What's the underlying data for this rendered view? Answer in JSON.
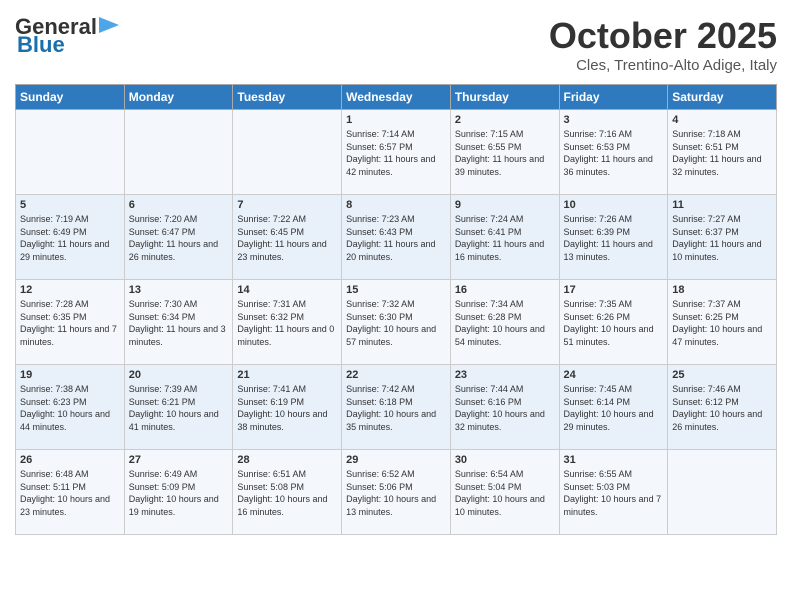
{
  "header": {
    "logo_line1": "General",
    "logo_line2": "Blue",
    "month": "October 2025",
    "location": "Cles, Trentino-Alto Adige, Italy"
  },
  "weekdays": [
    "Sunday",
    "Monday",
    "Tuesday",
    "Wednesday",
    "Thursday",
    "Friday",
    "Saturday"
  ],
  "weeks": [
    [
      {
        "day": "",
        "info": ""
      },
      {
        "day": "",
        "info": ""
      },
      {
        "day": "",
        "info": ""
      },
      {
        "day": "1",
        "info": "Sunrise: 7:14 AM\nSunset: 6:57 PM\nDaylight: 11 hours and 42 minutes."
      },
      {
        "day": "2",
        "info": "Sunrise: 7:15 AM\nSunset: 6:55 PM\nDaylight: 11 hours and 39 minutes."
      },
      {
        "day": "3",
        "info": "Sunrise: 7:16 AM\nSunset: 6:53 PM\nDaylight: 11 hours and 36 minutes."
      },
      {
        "day": "4",
        "info": "Sunrise: 7:18 AM\nSunset: 6:51 PM\nDaylight: 11 hours and 32 minutes."
      }
    ],
    [
      {
        "day": "5",
        "info": "Sunrise: 7:19 AM\nSunset: 6:49 PM\nDaylight: 11 hours and 29 minutes."
      },
      {
        "day": "6",
        "info": "Sunrise: 7:20 AM\nSunset: 6:47 PM\nDaylight: 11 hours and 26 minutes."
      },
      {
        "day": "7",
        "info": "Sunrise: 7:22 AM\nSunset: 6:45 PM\nDaylight: 11 hours and 23 minutes."
      },
      {
        "day": "8",
        "info": "Sunrise: 7:23 AM\nSunset: 6:43 PM\nDaylight: 11 hours and 20 minutes."
      },
      {
        "day": "9",
        "info": "Sunrise: 7:24 AM\nSunset: 6:41 PM\nDaylight: 11 hours and 16 minutes."
      },
      {
        "day": "10",
        "info": "Sunrise: 7:26 AM\nSunset: 6:39 PM\nDaylight: 11 hours and 13 minutes."
      },
      {
        "day": "11",
        "info": "Sunrise: 7:27 AM\nSunset: 6:37 PM\nDaylight: 11 hours and 10 minutes."
      }
    ],
    [
      {
        "day": "12",
        "info": "Sunrise: 7:28 AM\nSunset: 6:35 PM\nDaylight: 11 hours and 7 minutes."
      },
      {
        "day": "13",
        "info": "Sunrise: 7:30 AM\nSunset: 6:34 PM\nDaylight: 11 hours and 3 minutes."
      },
      {
        "day": "14",
        "info": "Sunrise: 7:31 AM\nSunset: 6:32 PM\nDaylight: 11 hours and 0 minutes."
      },
      {
        "day": "15",
        "info": "Sunrise: 7:32 AM\nSunset: 6:30 PM\nDaylight: 10 hours and 57 minutes."
      },
      {
        "day": "16",
        "info": "Sunrise: 7:34 AM\nSunset: 6:28 PM\nDaylight: 10 hours and 54 minutes."
      },
      {
        "day": "17",
        "info": "Sunrise: 7:35 AM\nSunset: 6:26 PM\nDaylight: 10 hours and 51 minutes."
      },
      {
        "day": "18",
        "info": "Sunrise: 7:37 AM\nSunset: 6:25 PM\nDaylight: 10 hours and 47 minutes."
      }
    ],
    [
      {
        "day": "19",
        "info": "Sunrise: 7:38 AM\nSunset: 6:23 PM\nDaylight: 10 hours and 44 minutes."
      },
      {
        "day": "20",
        "info": "Sunrise: 7:39 AM\nSunset: 6:21 PM\nDaylight: 10 hours and 41 minutes."
      },
      {
        "day": "21",
        "info": "Sunrise: 7:41 AM\nSunset: 6:19 PM\nDaylight: 10 hours and 38 minutes."
      },
      {
        "day": "22",
        "info": "Sunrise: 7:42 AM\nSunset: 6:18 PM\nDaylight: 10 hours and 35 minutes."
      },
      {
        "day": "23",
        "info": "Sunrise: 7:44 AM\nSunset: 6:16 PM\nDaylight: 10 hours and 32 minutes."
      },
      {
        "day": "24",
        "info": "Sunrise: 7:45 AM\nSunset: 6:14 PM\nDaylight: 10 hours and 29 minutes."
      },
      {
        "day": "25",
        "info": "Sunrise: 7:46 AM\nSunset: 6:12 PM\nDaylight: 10 hours and 26 minutes."
      }
    ],
    [
      {
        "day": "26",
        "info": "Sunrise: 6:48 AM\nSunset: 5:11 PM\nDaylight: 10 hours and 23 minutes."
      },
      {
        "day": "27",
        "info": "Sunrise: 6:49 AM\nSunset: 5:09 PM\nDaylight: 10 hours and 19 minutes."
      },
      {
        "day": "28",
        "info": "Sunrise: 6:51 AM\nSunset: 5:08 PM\nDaylight: 10 hours and 16 minutes."
      },
      {
        "day": "29",
        "info": "Sunrise: 6:52 AM\nSunset: 5:06 PM\nDaylight: 10 hours and 13 minutes."
      },
      {
        "day": "30",
        "info": "Sunrise: 6:54 AM\nSunset: 5:04 PM\nDaylight: 10 hours and 10 minutes."
      },
      {
        "day": "31",
        "info": "Sunrise: 6:55 AM\nSunset: 5:03 PM\nDaylight: 10 hours and 7 minutes."
      },
      {
        "day": "",
        "info": ""
      }
    ]
  ]
}
